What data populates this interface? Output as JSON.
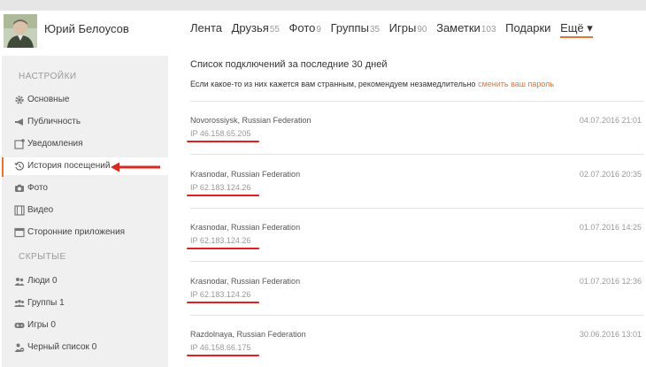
{
  "profile": {
    "name": "Юрий Белоусов"
  },
  "nav": {
    "items": [
      {
        "label": "Лента",
        "count": ""
      },
      {
        "label": "Друзья",
        "count": "55"
      },
      {
        "label": "Фото",
        "count": "9"
      },
      {
        "label": "Группы",
        "count": "35"
      },
      {
        "label": "Игры",
        "count": "90"
      },
      {
        "label": "Заметки",
        "count": "103"
      },
      {
        "label": "Подарки",
        "count": ""
      }
    ],
    "more": "Ещё ▾"
  },
  "sidebar": {
    "settings_header": "НАСТРОЙКИ",
    "settings_items": [
      {
        "label": "Основные",
        "icon": "gear-icon"
      },
      {
        "label": "Публичность",
        "icon": "megaphone-icon"
      },
      {
        "label": "Уведомления",
        "icon": "notification-icon"
      },
      {
        "label": "История посещений",
        "icon": "history-icon",
        "active": true
      },
      {
        "label": "Фото",
        "icon": "camera-icon"
      },
      {
        "label": "Видео",
        "icon": "film-icon"
      },
      {
        "label": "Сторонние приложения",
        "icon": "app-window-icon"
      }
    ],
    "hidden_header": "СКРЫТЫЕ",
    "hidden_items": [
      {
        "label": "Люди 0",
        "icon": "people-icon"
      },
      {
        "label": "Группы 1",
        "icon": "groups-icon"
      },
      {
        "label": "Игры 0",
        "icon": "gamepad-icon"
      },
      {
        "label": "Черный список 0",
        "icon": "blocked-user-icon"
      }
    ]
  },
  "content": {
    "title": "Список подключений за последние 30 дней",
    "notice_text": "Если какое-то из них кажется вам странным, рекомендуем незамедлительно",
    "notice_link": "сменить ваш пароль",
    "entries": [
      {
        "location": "Novorossiysk, Russian Federation",
        "ip": "IP 46.158.65.205",
        "date": "04.07.2016 21:01"
      },
      {
        "location": "Krasnodar, Russian Federation",
        "ip": "IP 62.183.124.26",
        "date": "02.07.2016 20:35"
      },
      {
        "location": "Krasnodar, Russian Federation",
        "ip": "IP 62.183.124.26",
        "date": "01.07.2016 14:25"
      },
      {
        "location": "Krasnodar, Russian Federation",
        "ip": "IP 62.183.124.26",
        "date": "01.07.2016 12:36"
      },
      {
        "location": "Razdolnaya, Russian Federation",
        "ip": "IP 46.158.66.175",
        "date": "30.06.2016 13:01"
      }
    ]
  },
  "colors": {
    "accent": "#eb722e",
    "highlight": "#e02020",
    "sidebar_bg": "#f0f0f0"
  }
}
